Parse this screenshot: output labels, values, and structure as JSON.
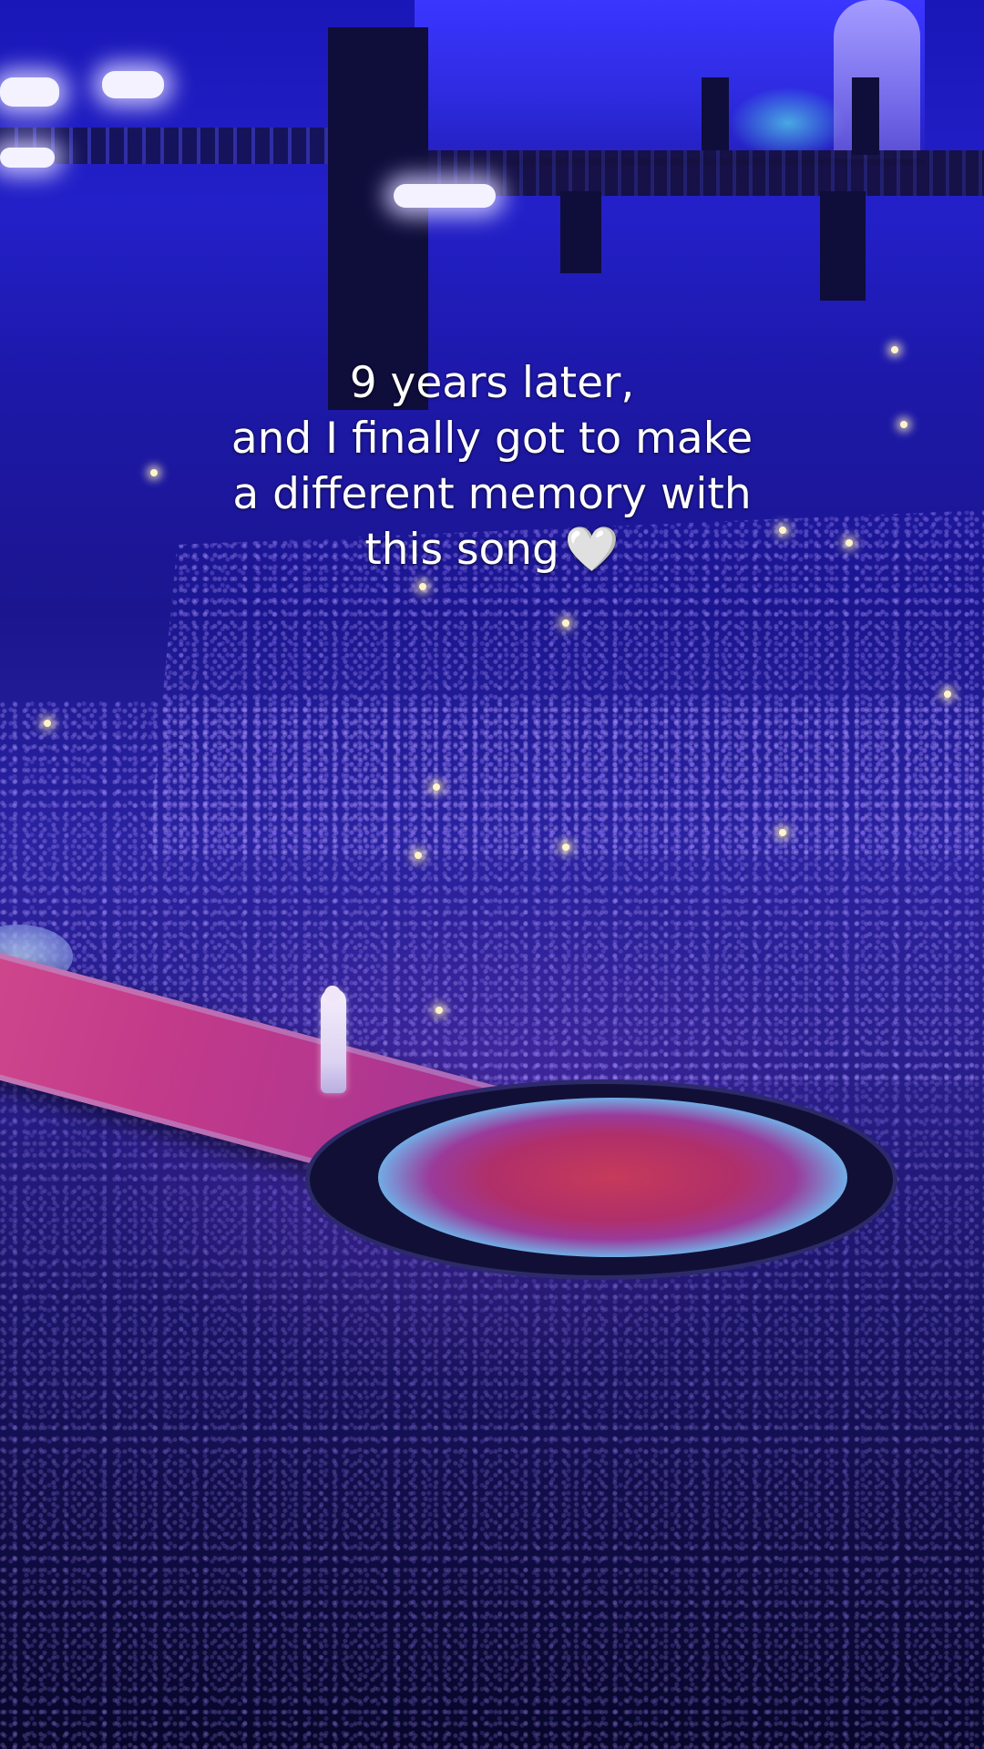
{
  "caption": {
    "lines": [
      "9 years later,",
      "and I finally got to make",
      "a different memory with",
      "this song"
    ],
    "emoji": "🤍"
  },
  "scene": {
    "background_color": "#1d18a8",
    "runway_color": "#c33a8a",
    "stage_color": "#b02f6a"
  }
}
